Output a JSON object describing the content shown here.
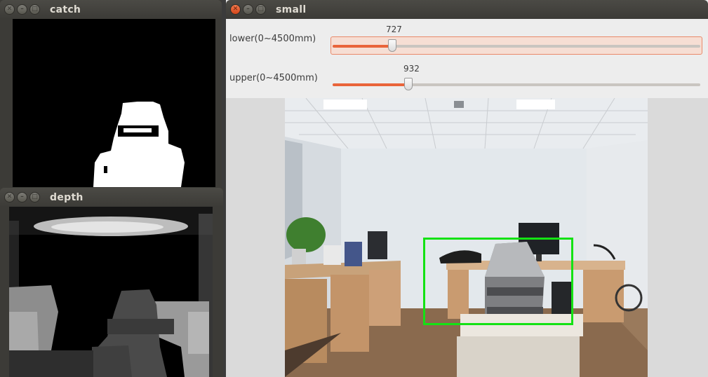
{
  "windows": {
    "catch": {
      "title": "catch"
    },
    "depth": {
      "title": "depth"
    },
    "small": {
      "title": "small",
      "trackbars": [
        {
          "label": "lower(0~4500mm)",
          "value": "727",
          "min": 0,
          "max": 4500,
          "fraction": 0.162
        },
        {
          "label": "upper(0~4500mm)",
          "value": "932",
          "min": 0,
          "max": 4500,
          "fraction": 0.207
        }
      ]
    }
  },
  "colors": {
    "accent": "#e9643a",
    "detection_box": "#14e214",
    "titlebar": "#3c3b37"
  },
  "icons": [
    "close-icon",
    "minimize-icon",
    "maximize-icon"
  ]
}
